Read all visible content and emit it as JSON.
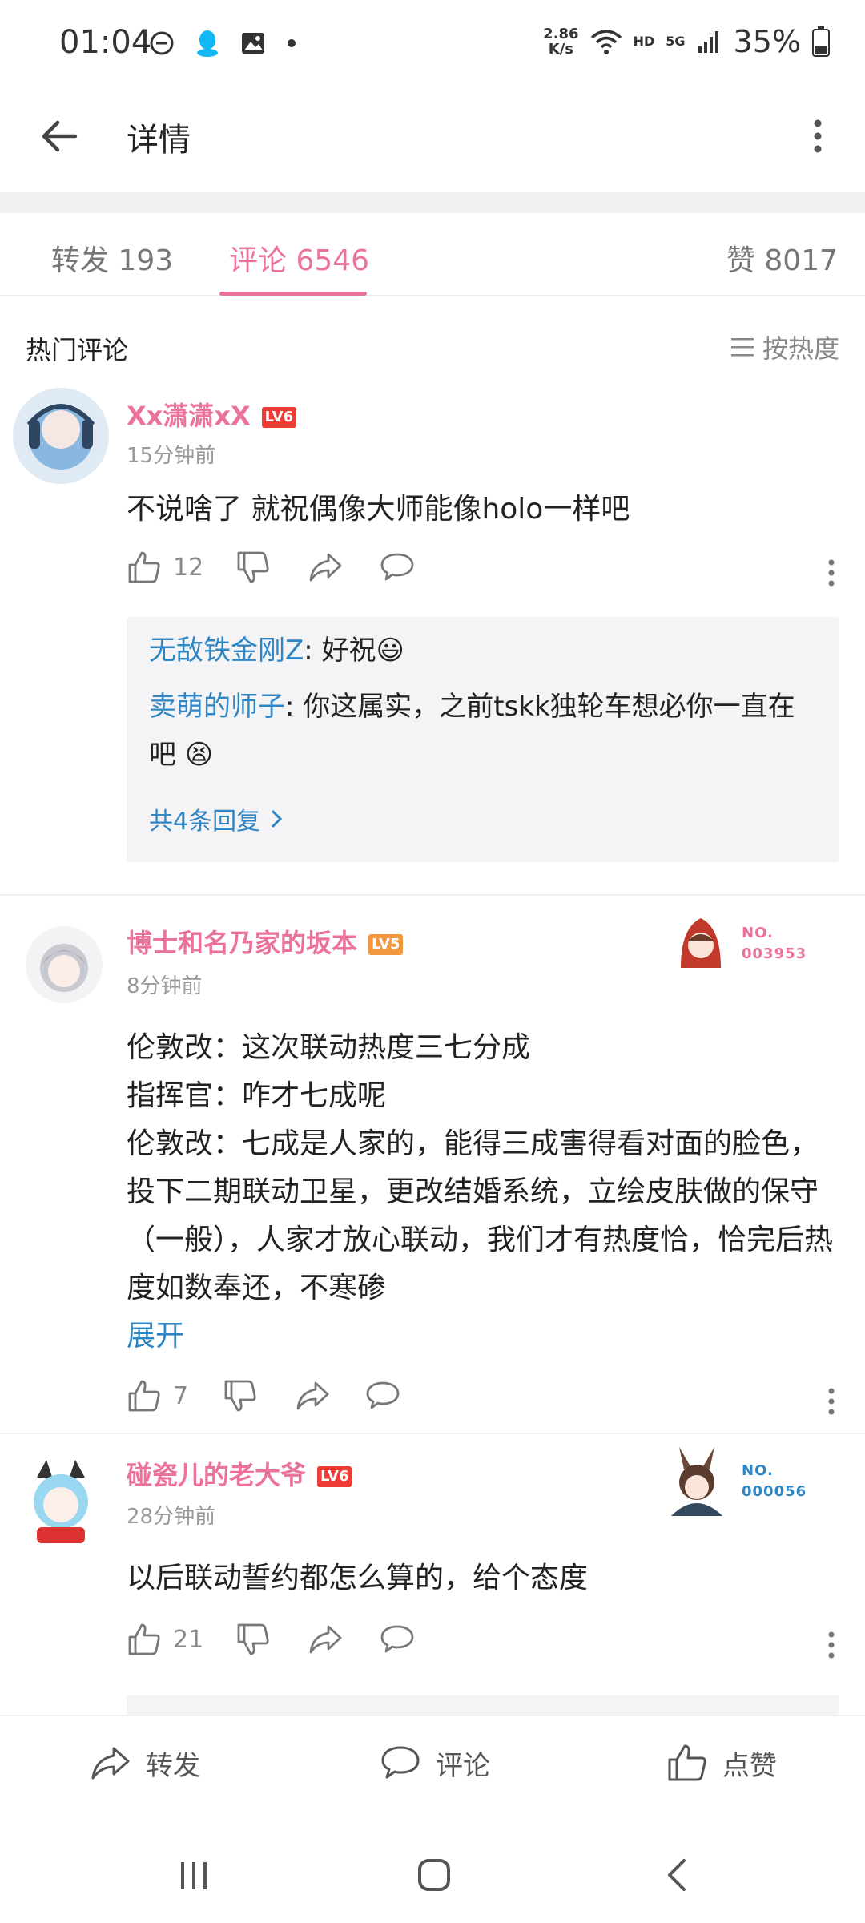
{
  "status": {
    "time": "01:04",
    "speed_value": "2.86",
    "speed_unit": "K/s",
    "hd": "HD",
    "net": "5G",
    "battery": "35%"
  },
  "header": {
    "title": "详情"
  },
  "tabs": {
    "forward": "转发 193",
    "comments": "评论 6546",
    "likes": "赞 8017"
  },
  "section": {
    "title": "热门评论",
    "sort": "按热度"
  },
  "comments": [
    {
      "user": "Xx潇潇xX",
      "level": "LV6",
      "time": "15分钟前",
      "text": "不说啥了 就祝偶像大师能像holo一样吧",
      "like_count": "12",
      "replies": [
        {
          "name": "无敌铁金刚Z",
          "text": ": 好祝😃"
        },
        {
          "name": "卖萌的师子",
          "text": ": 你这属实，之前tskk独轮车想必你一直在吧 😫"
        }
      ],
      "replies_more": "共4条回复"
    },
    {
      "user": "博士和名乃家的坂本",
      "level": "LV5",
      "time": "8分钟前",
      "text": "伦敦改：这次联动热度三七分成\n指挥官：咋才七成呢\n伦敦改：七成是人家的，能得三成害得看对面的脸色，投下二期联动卫星，更改结婚系统，立绘皮肤做的保守（一般），人家才放心联动，我们才有热度恰，恰完后热度如数奉还，不寒碜",
      "expand": "展开",
      "like_count": "7",
      "badge_no": "NO.",
      "badge_num": "003953"
    },
    {
      "user": "碰瓷儿的老大爷",
      "level": "LV6",
      "time": "28分钟前",
      "text": "以后联动誓约都怎么算的，给个态度",
      "like_count": "21",
      "badge_no": "NO.",
      "badge_num": "000056"
    }
  ],
  "bottom": {
    "forward": "转发",
    "comment": "评论",
    "like": "点赞"
  },
  "colors": {
    "accent": "#eb7399",
    "link": "#2f86c4",
    "text": "#222222",
    "secondary": "#999999"
  }
}
